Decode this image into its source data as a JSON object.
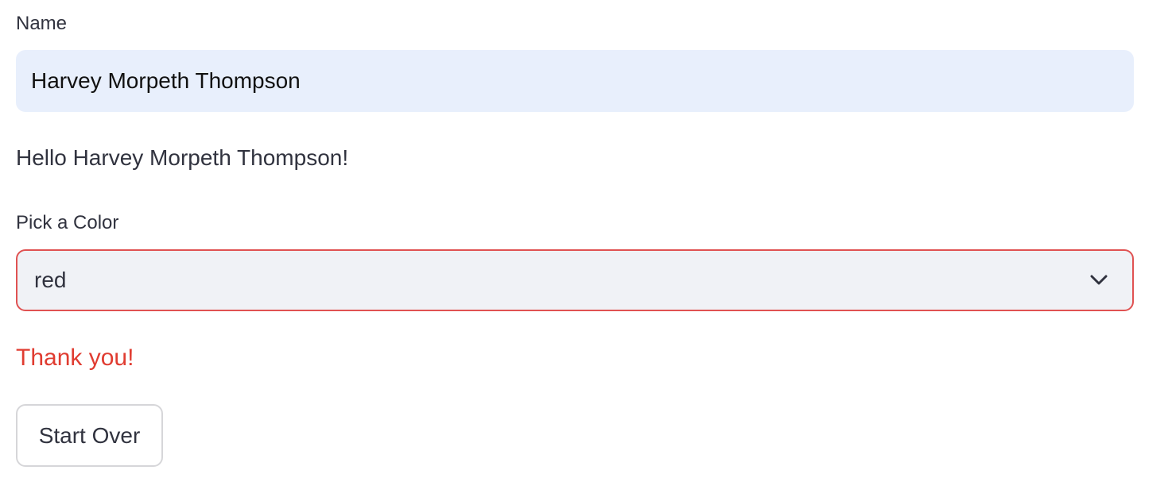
{
  "name_field": {
    "label": "Name",
    "value": "Harvey Morpeth Thompson"
  },
  "greeting": {
    "text": "Hello Harvey Morpeth Thompson!"
  },
  "color_select": {
    "label": "Pick a Color",
    "selected": "red",
    "border_color": "#e05252"
  },
  "message": {
    "text": "Thank you!",
    "color": "#e03c31"
  },
  "start_over": {
    "label": "Start Over"
  },
  "icons": {
    "select_chevron": "chevron-down-icon"
  }
}
